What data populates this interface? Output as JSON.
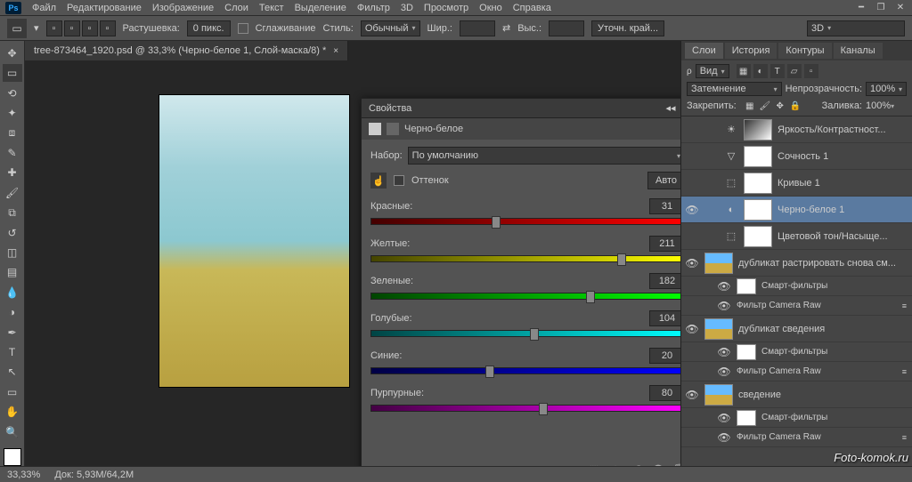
{
  "menu": [
    "Файл",
    "Редактирование",
    "Изображение",
    "Слои",
    "Текст",
    "Выделение",
    "Фильтр",
    "3D",
    "Просмотр",
    "Окно",
    "Справка"
  ],
  "options": {
    "feather_label": "Растушевка:",
    "feather_value": "0 пикс.",
    "antialias_label": "Сглаживание",
    "style_label": "Стиль:",
    "style_value": "Обычный",
    "width_label": "Шир.:",
    "height_label": "Выс.:",
    "refine_label": "Уточн. край...",
    "workspace_value": "3D"
  },
  "doc_tab": "tree-873464_1920.psd @ 33,3% (Черно-белое 1, Слой-маска/8) *",
  "properties": {
    "panel_title": "Свойства",
    "adj_title": "Черно-белое",
    "preset_label": "Набор:",
    "preset_value": "По умолчанию",
    "tint_label": "Оттенок",
    "auto_label": "Авто",
    "sliders": [
      {
        "label": "Красные:",
        "value": "31",
        "class": "red",
        "pos": 40
      },
      {
        "label": "Желтые:",
        "value": "211",
        "class": "yellow",
        "pos": 80
      },
      {
        "label": "Зеленые:",
        "value": "182",
        "class": "green",
        "pos": 70
      },
      {
        "label": "Голубые:",
        "value": "104",
        "class": "cyan",
        "pos": 52
      },
      {
        "label": "Синие:",
        "value": "20",
        "class": "blue",
        "pos": 38
      },
      {
        "label": "Пурпурные:",
        "value": "80",
        "class": "magenta",
        "pos": 55
      }
    ]
  },
  "layers_panel": {
    "tabs": [
      "Слои",
      "История",
      "Контуры",
      "Каналы"
    ],
    "filter_label": "Вид",
    "blend_value": "Затемнение",
    "opacity_label": "Непрозрачность:",
    "opacity_value": "100%",
    "lock_label": "Закрепить:",
    "fill_label": "Заливка:",
    "fill_value": "100%",
    "layers": [
      {
        "vis": "",
        "icon": "☀",
        "thumb": "grad",
        "name": "Яркость/Контрастност..."
      },
      {
        "vis": "",
        "icon": "▽",
        "thumb": "white",
        "name": "Сочность 1"
      },
      {
        "vis": "",
        "icon": "⬚",
        "thumb": "white",
        "name": "Кривые 1"
      },
      {
        "vis": "👁",
        "icon": "◐",
        "thumb": "white",
        "name": "Черно-белое 1",
        "sel": true
      },
      {
        "vis": "",
        "icon": "⬚",
        "thumb": "white",
        "name": "Цветовой тон/Насыще..."
      },
      {
        "vis": "👁",
        "icon": "",
        "thumb": "img",
        "name": "дубликат растрировать снова см...",
        "smart": true
      },
      {
        "vis": "👁",
        "icon": "",
        "thumb": "img",
        "name": "дубликат сведения",
        "smart": true
      },
      {
        "vis": "👁",
        "icon": "",
        "thumb": "img",
        "name": "сведение",
        "smart": true
      }
    ],
    "smart_filters_label": "Смарт-фильтры",
    "camera_raw_label": "Фильтр Camera Raw"
  },
  "status": {
    "zoom": "33,33%",
    "doc_size_label": "Док:",
    "doc_size": "5,93M/64,2M"
  },
  "watermark": "Foto-komok.ru"
}
